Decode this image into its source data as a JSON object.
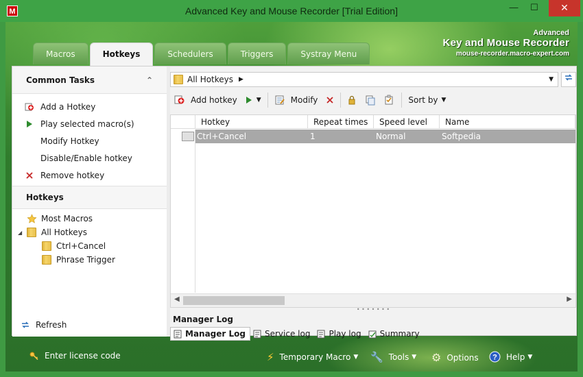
{
  "window": {
    "title": "Advanced Key and Mouse Recorder [Trial Edition]",
    "icon_letter": "M",
    "min_label": "—",
    "max_label": "☐",
    "close_label": "✕"
  },
  "brand": {
    "line1": "Advanced",
    "line2": "Key and Mouse Recorder",
    "line3": "mouse-recorder.macro-expert.com"
  },
  "tabs": [
    {
      "label": "Macros",
      "active": false
    },
    {
      "label": "Hotkeys",
      "active": true
    },
    {
      "label": "Schedulers",
      "active": false
    },
    {
      "label": "Triggers",
      "active": false
    },
    {
      "label": "Systray Menu",
      "active": false
    }
  ],
  "left": {
    "common_tasks_title": "Common Tasks",
    "collapse_symbol": "⌃",
    "tasks": [
      {
        "label": "Add a Hotkey",
        "icon": "add-icon"
      },
      {
        "label": "Play selected macro(s)",
        "icon": "play-icon"
      },
      {
        "label": "Modify Hotkey",
        "icon": ""
      },
      {
        "label": "Disable/Enable hotkey",
        "icon": ""
      },
      {
        "label": "Remove hotkey",
        "icon": "remove-icon"
      }
    ],
    "hotkeys_title": "Hotkeys",
    "tree": [
      {
        "label": "Most Macros",
        "icon": "star-icon",
        "level": 1
      },
      {
        "label": "All Hotkeys",
        "icon": "folder-icon",
        "level": 1,
        "expanded": true
      },
      {
        "label": "Ctrl+Cancel",
        "icon": "folder-icon",
        "level": 2
      },
      {
        "label": "Phrase Trigger",
        "icon": "folder-icon",
        "level": 2
      }
    ],
    "refresh_label": "Refresh"
  },
  "address": {
    "path": "All Hotkeys"
  },
  "toolbar": {
    "add_label": "Add hotkey",
    "modify_label": "Modify",
    "sort_label": "Sort by"
  },
  "grid": {
    "columns": [
      "Hotkey",
      "Repeat times",
      "Speed level",
      "Name"
    ],
    "rows": [
      {
        "hotkey": "Ctrl+Cancel",
        "repeat": "1",
        "speed": "Normal",
        "name": "Softpedia"
      }
    ]
  },
  "log": {
    "title": "Manager Log",
    "tabs": [
      {
        "label": "Manager Log",
        "active": true
      },
      {
        "label": "Service log",
        "active": false
      },
      {
        "label": "Play log",
        "active": false
      },
      {
        "label": "Summary",
        "active": false
      }
    ]
  },
  "status": {
    "license": "Enter license code",
    "temporary_macro": "Temporary Macro",
    "tools": "Tools",
    "options": "Options",
    "help": "Help"
  },
  "colors": {
    "accent_green": "#3ea346",
    "selection_gray": "#a8a8a8",
    "close_red": "#c7342b"
  }
}
